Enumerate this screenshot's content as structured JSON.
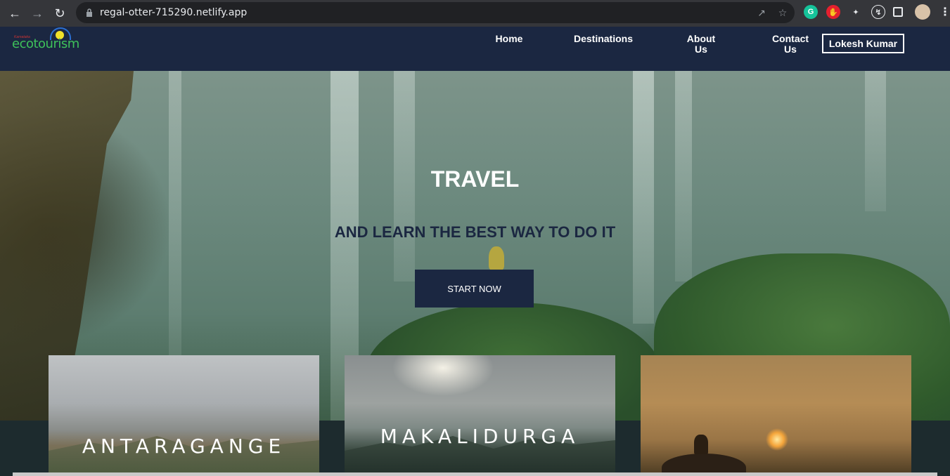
{
  "browser": {
    "url": "regal-otter-715290.netlify.app",
    "extensions": [
      "grammarly-icon",
      "adblock-icon",
      "puzzle-icon",
      "lightning-icon"
    ]
  },
  "site": {
    "logo_text": "ecotourism",
    "logo_tagline": "Karnataka",
    "nav": [
      {
        "label": "Home"
      },
      {
        "label": "Destinations"
      },
      {
        "label": "About Us"
      },
      {
        "label": "Contact Us"
      }
    ],
    "user_label": "Lokesh Kumar"
  },
  "hero": {
    "title": "TRAVEL",
    "subtitle": "AND LEARN THE BEST WAY TO DO IT",
    "cta_label": "START NOW"
  },
  "cards": [
    {
      "label": "ANTARAGANGE"
    },
    {
      "label": "MAKALIDURGA"
    },
    {
      "label": ""
    }
  ],
  "colors": {
    "header_bg": "#1b2741",
    "accent_green": "#3ec15a"
  }
}
